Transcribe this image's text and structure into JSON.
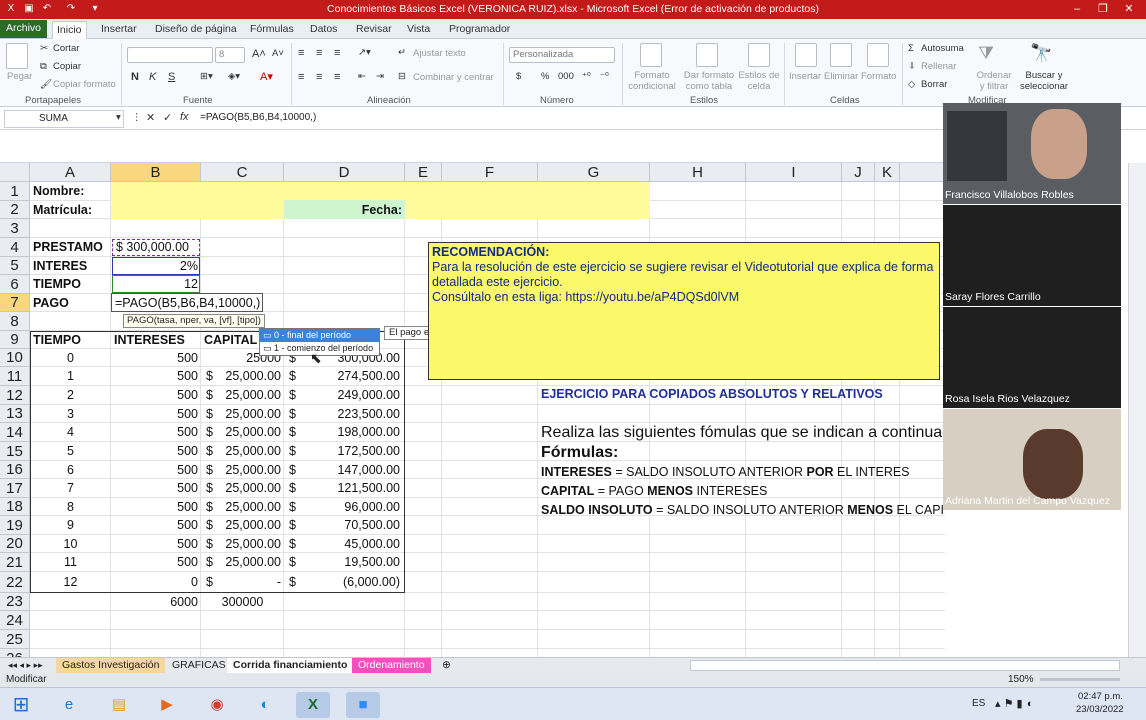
{
  "window": {
    "title": "Conocimientos Básicos Excel (VERONICA RUIZ).xlsx  -  Microsoft Excel (Error de activación de productos)"
  },
  "ribbon_tabs": [
    "Archivo",
    "Inicio",
    "Insertar",
    "Diseño de página",
    "Fórmulas",
    "Datos",
    "Revisar",
    "Vista",
    "Programador"
  ],
  "ribbon": {
    "clipboard": {
      "paste": "Pegar",
      "cut": "Cortar",
      "copy": "Copiar",
      "format_painter": "Copiar formato",
      "group": "Portapapeles"
    },
    "font": {
      "size": "8",
      "group": "Fuente",
      "bold": "N",
      "italic": "K",
      "underline": "S"
    },
    "alignment": {
      "wrap": "Ajustar texto",
      "merge": "Combinar y centrar",
      "group": "Alineación"
    },
    "number": {
      "format": "Personalizada",
      "currency": "$",
      "percent": "%",
      "thousands": "000",
      "group": "Número"
    },
    "styles": {
      "conditional": "Formato condicional",
      "table": "Dar formato como tabla",
      "cell": "Estilos de celda",
      "group": "Estilos"
    },
    "cells": {
      "insert": "Insertar",
      "delete": "Eliminar",
      "format": "Formato",
      "group": "Celdas"
    },
    "editing": {
      "autosum": "Autosuma",
      "fill": "Rellenar",
      "clear": "Borrar",
      "sort": "Ordenar y filtrar",
      "find": "Buscar y seleccionar",
      "group": "Modificar"
    }
  },
  "formula_bar": {
    "name_box": "SUMA",
    "formula": "=PAGO(B5,B6,B4,10000,)"
  },
  "columns": [
    "A",
    "B",
    "C",
    "D",
    "E",
    "F",
    "G",
    "H",
    "I",
    "J",
    "K"
  ],
  "rows": [
    "1",
    "2",
    "3",
    "4",
    "5",
    "6",
    "7",
    "8",
    "9",
    "10",
    "11",
    "12",
    "13",
    "14",
    "15",
    "16",
    "17",
    "18",
    "19",
    "20",
    "21",
    "22",
    "23",
    "24",
    "25",
    "26"
  ],
  "sheet": {
    "nombre": "Nombre:",
    "matricula": "Matrícula:",
    "fecha": "Fecha:",
    "prestamo_label": "PRESTAMO",
    "prestamo_value": "$  300,000.00",
    "interes_label": "INTERES",
    "interes_value": "2%",
    "tiempo_label": "TIEMPO",
    "tiempo_value": "12",
    "pago_label": "PAGO",
    "pago_formula": "=PAGO(B5,B6,B4,10000,)",
    "tooltip": "PAGO(tasa, nper, va, [vf], [tipo])",
    "dropdown_opt0": "0 - final del período",
    "dropdown_opt1": "1 - comienzo del período",
    "dropdown_hint": "El pago está previsto para el final de período",
    "hdr_tiempo": "TIEMPO",
    "hdr_intereses": "INTERESES",
    "hdr_capital": "CAPITAL",
    "tot_intereses": "6000",
    "tot_capital": "300000",
    "amort": [
      {
        "t": "0",
        "i": "500",
        "c": "25000",
        "s": "300,000.00"
      },
      {
        "t": "1",
        "i": "500",
        "c": "25,000.00",
        "s": "274,500.00"
      },
      {
        "t": "2",
        "i": "500",
        "c": "25,000.00",
        "s": "249,000.00"
      },
      {
        "t": "3",
        "i": "500",
        "c": "25,000.00",
        "s": "223,500.00"
      },
      {
        "t": "4",
        "i": "500",
        "c": "25,000.00",
        "s": "198,000.00"
      },
      {
        "t": "5",
        "i": "500",
        "c": "25,000.00",
        "s": "172,500.00"
      },
      {
        "t": "6",
        "i": "500",
        "c": "25,000.00",
        "s": "147,000.00"
      },
      {
        "t": "7",
        "i": "500",
        "c": "25,000.00",
        "s": "121,500.00"
      },
      {
        "t": "8",
        "i": "500",
        "c": "25,000.00",
        "s": "96,000.00"
      },
      {
        "t": "9",
        "i": "500",
        "c": "25,000.00",
        "s": "70,500.00"
      },
      {
        "t": "10",
        "i": "500",
        "c": "25,000.00",
        "s": "45,000.00"
      },
      {
        "t": "11",
        "i": "500",
        "c": "25,000.00",
        "s": "19,500.00"
      },
      {
        "t": "12",
        "i": "0",
        "c": "-",
        "s": "(6,000.00)"
      }
    ],
    "reco_title": "RECOMENDACIÓN:",
    "reco_text": "Para la resolución  de este ejercicio se sugiere revisar el Videotutorial que explica de forma detallada  este ejercicio.",
    "reco_link": "Consúltalo  en esta liga: https://youtu.be/aP4DQSd0lVM",
    "ejercicio": "EJERCICIO PARA  COPIADOS ABSOLUTOS Y RELATIVOS",
    "realiza": "Realiza las siguientes fómulas que se indican a continuaci",
    "formulas": "Fórmulas:",
    "f1a": "INTERESES",
    "f1b": " = SALDO INSOLUTO ANTERIOR ",
    "f1c": "POR",
    "f1d": " EL INTERES",
    "f2a": "CAPITAL",
    "f2b": " = PAGO ",
    "f2c": "MENOS",
    "f2d": " INTERESES",
    "f3a": "SALDO INSOLUTO",
    "f3b": " = SALDO INSOLUTO ANTERIOR ",
    "f3c": "MENOS",
    "f3d": " EL CAPITAL"
  },
  "participants": [
    "Francisco Villalobos Robles",
    "Saray Flores Carrillo",
    "Rosa Isela Rios Velazquez",
    "Adriana Martin del Campo Vazquez"
  ],
  "sheet_tabs": [
    "Gastos Investigación",
    "GRAFICAS",
    "Corrida financiamiento",
    "Ordenamiento"
  ],
  "status": {
    "mode": "Modificar",
    "zoom": "150%"
  },
  "taskbar": {
    "lang": "ES",
    "time": "02:47 p.m.",
    "date": "23/03/2022"
  }
}
